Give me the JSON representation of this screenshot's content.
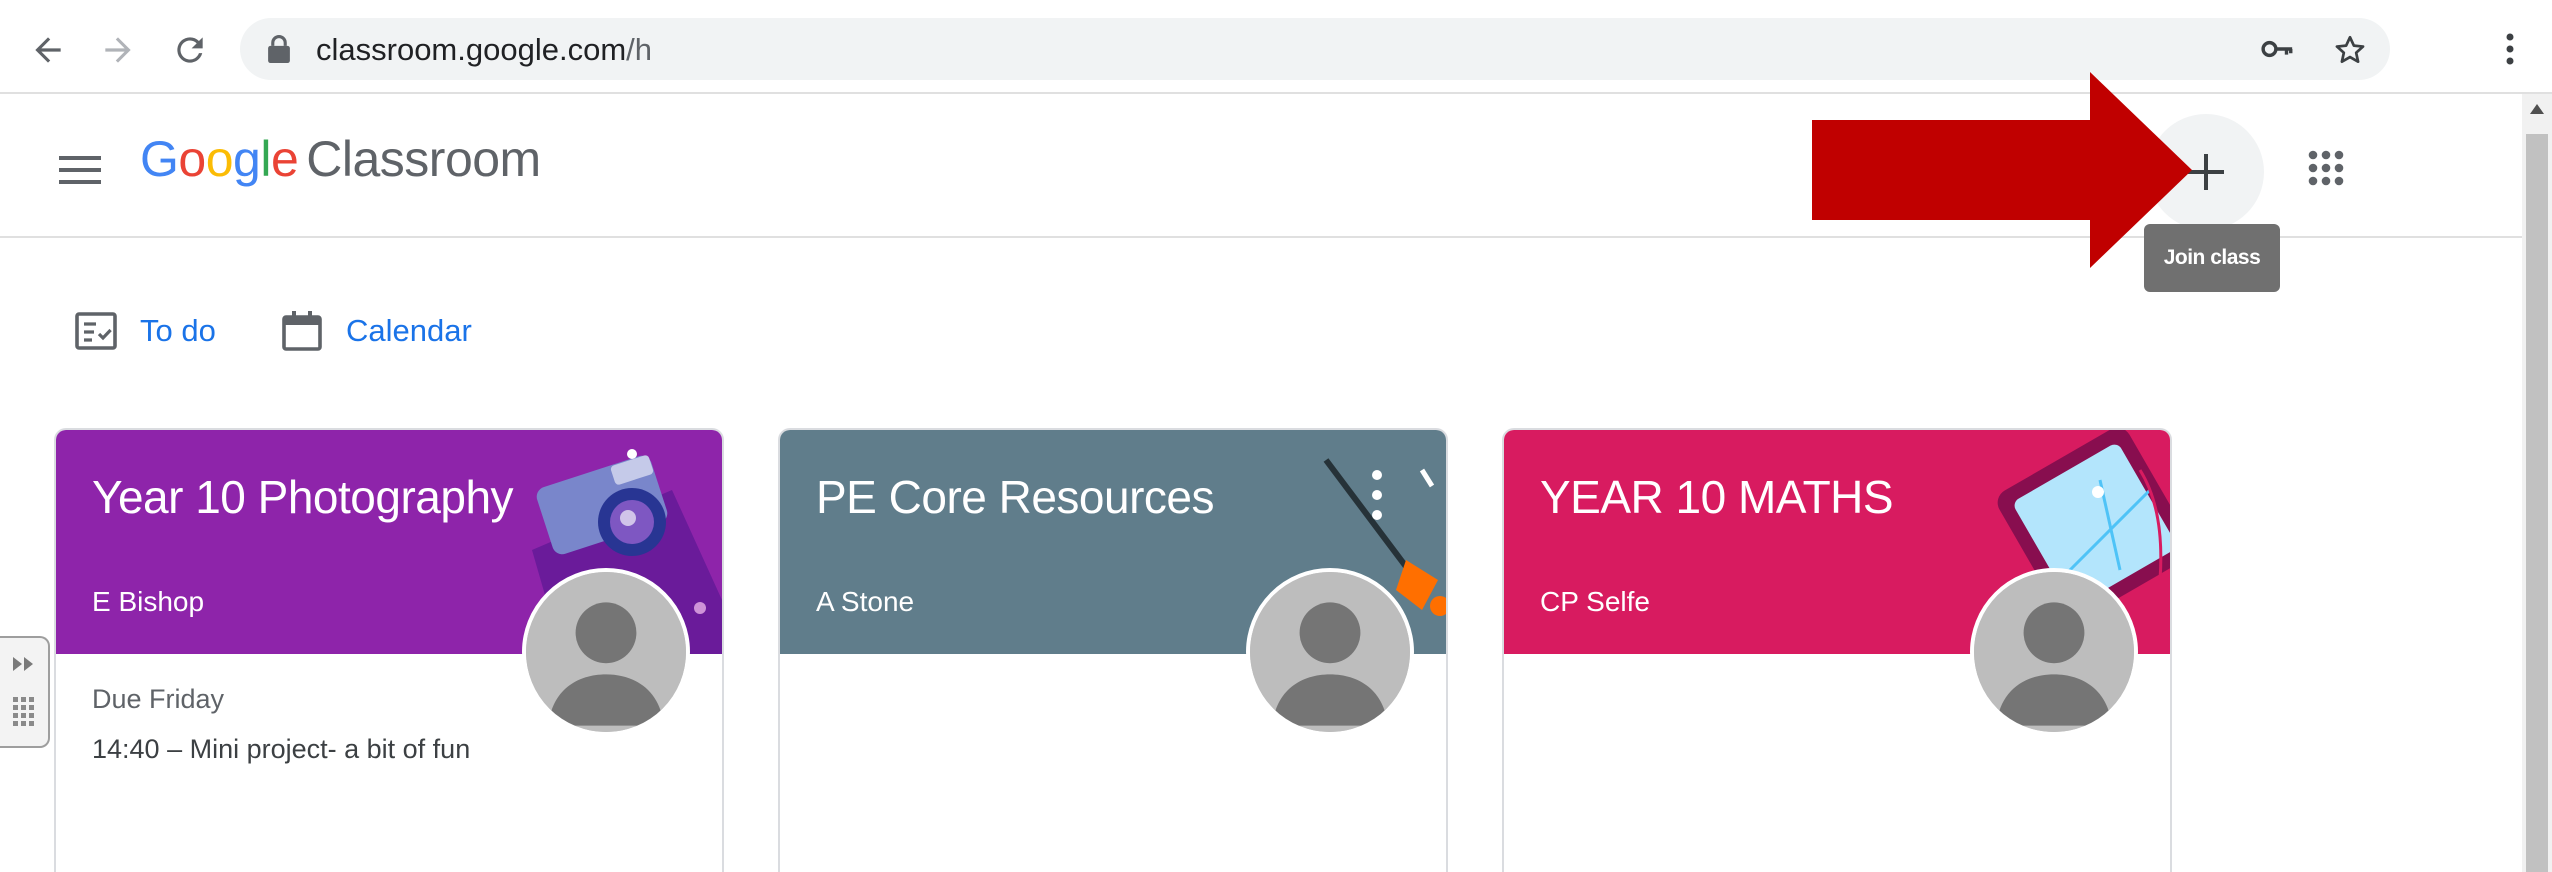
{
  "browser": {
    "url_host": "classroom.google.com",
    "url_path": "/h"
  },
  "header": {
    "logo_brand": [
      "G",
      "o",
      "o",
      "g",
      "l",
      "e"
    ],
    "logo_colors": [
      "#4285f4",
      "#ea4335",
      "#fbbc05",
      "#4285f4",
      "#34a853",
      "#ea4335"
    ],
    "logo_product": "Classroom",
    "add_button_icon": "plus-icon",
    "apps_button_icon": "apps-grid-icon",
    "tooltip": "Join class"
  },
  "quick_links": {
    "todo_label": "To do",
    "calendar_label": "Calendar"
  },
  "cards": [
    {
      "title": "Year 10 Photography",
      "teacher": "E Bishop",
      "color": "#8e24aa",
      "due_label": "Due Friday",
      "due_item": "14:40 – Mini project- a bit of fun"
    },
    {
      "title": "PE Core Resources",
      "teacher": "A Stone",
      "color": "#607d8b"
    },
    {
      "title": "YEAR 10 MATHS",
      "teacher": "CP Selfe",
      "color": "#d81b60"
    }
  ],
  "colors": {
    "accent": "#1a73e8",
    "annotation_arrow": "#c00000"
  }
}
